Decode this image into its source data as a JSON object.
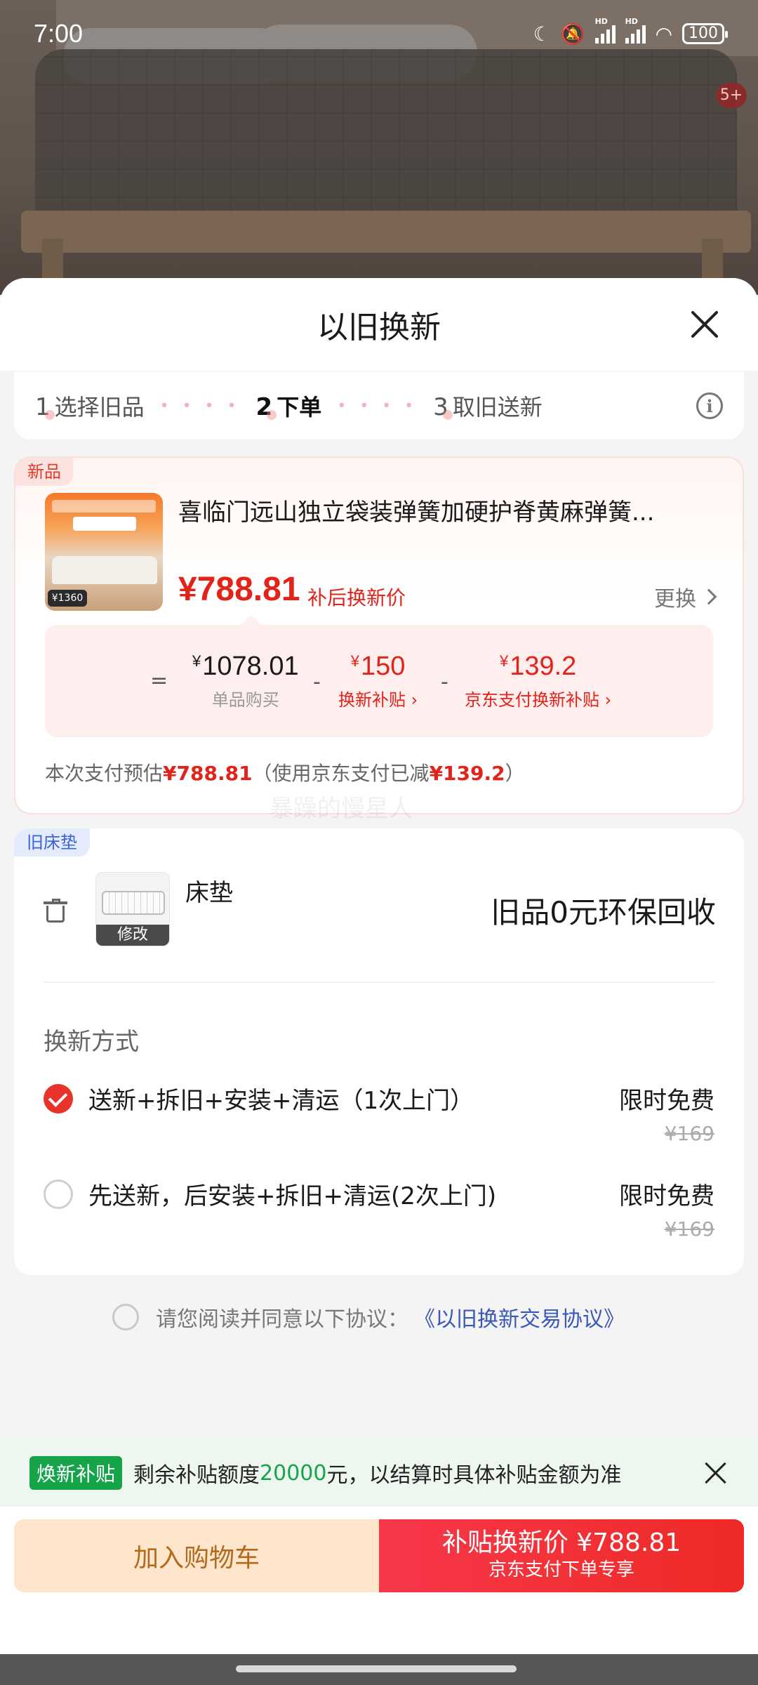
{
  "status_bar": {
    "time": "7:00",
    "battery": "100",
    "net1": "HD",
    "net2": "HD"
  },
  "background": {
    "cart_badge": "5+"
  },
  "sheet": {
    "title": "以旧换新",
    "steps": [
      {
        "num": "1",
        "label": "选择旧品"
      },
      {
        "num": "2",
        "label": "下单"
      },
      {
        "num": "3",
        "label": "取旧送新"
      }
    ],
    "step_dots": "• • • •",
    "info_glyph": "i"
  },
  "new_product": {
    "tag": "新品",
    "title": "喜临门远山独立袋装弹簧加硬护脊黄麻弹簧...",
    "price": "¥788.81",
    "price_label": "补后换新价",
    "change_label": "更换",
    "thumb_price": "¥1360",
    "calc": {
      "eq": "=",
      "minus": "-",
      "yen": "¥",
      "base_value": "1078.01",
      "base_label": "单品购买",
      "subsidy_value": "150",
      "subsidy_label": "换新补贴 ›",
      "jdpay_value": "139.2",
      "jdpay_label": "京东支付换新补贴 ›"
    },
    "estimate_prefix": "本次支付预估",
    "estimate_amount": "¥788.81",
    "estimate_mid": "（使用京东支付已减",
    "estimate_discount": "¥139.2",
    "estimate_suffix": "）"
  },
  "watermark": "暴躁的慢星人",
  "old_item": {
    "tag": "旧床垫",
    "name": "床垫",
    "edit_label": "修改",
    "recycle_text": "旧品0元环保回收",
    "method_title": "换新方式",
    "options": [
      {
        "label": "送新+拆旧+安装+清运（1次上门）",
        "price": "限时免费",
        "original": "¥169",
        "checked": true
      },
      {
        "label": "先送新，后安装+拆旧+清运(2次上门)",
        "price": "限时免费",
        "original": "¥169",
        "checked": false
      }
    ]
  },
  "agreement": {
    "text": "请您阅读并同意以下协议：",
    "link": "《以旧换新交易协议》"
  },
  "subsidy_banner": {
    "badge": "焕新补贴",
    "text_before": "剩余补贴额度",
    "amount": "20000",
    "text_after": "元，以结算时具体补贴金额为准"
  },
  "bottom": {
    "cart_label": "加入购物车",
    "buy_main": "补贴换新价 ¥788.81",
    "buy_sub": "京东支付下单专享"
  },
  "colors": {
    "accent_red": "#e2231a",
    "subsidy_green": "#16a44a",
    "link_blue": "#3a58b8",
    "cart_orange": "#b46a1e"
  }
}
